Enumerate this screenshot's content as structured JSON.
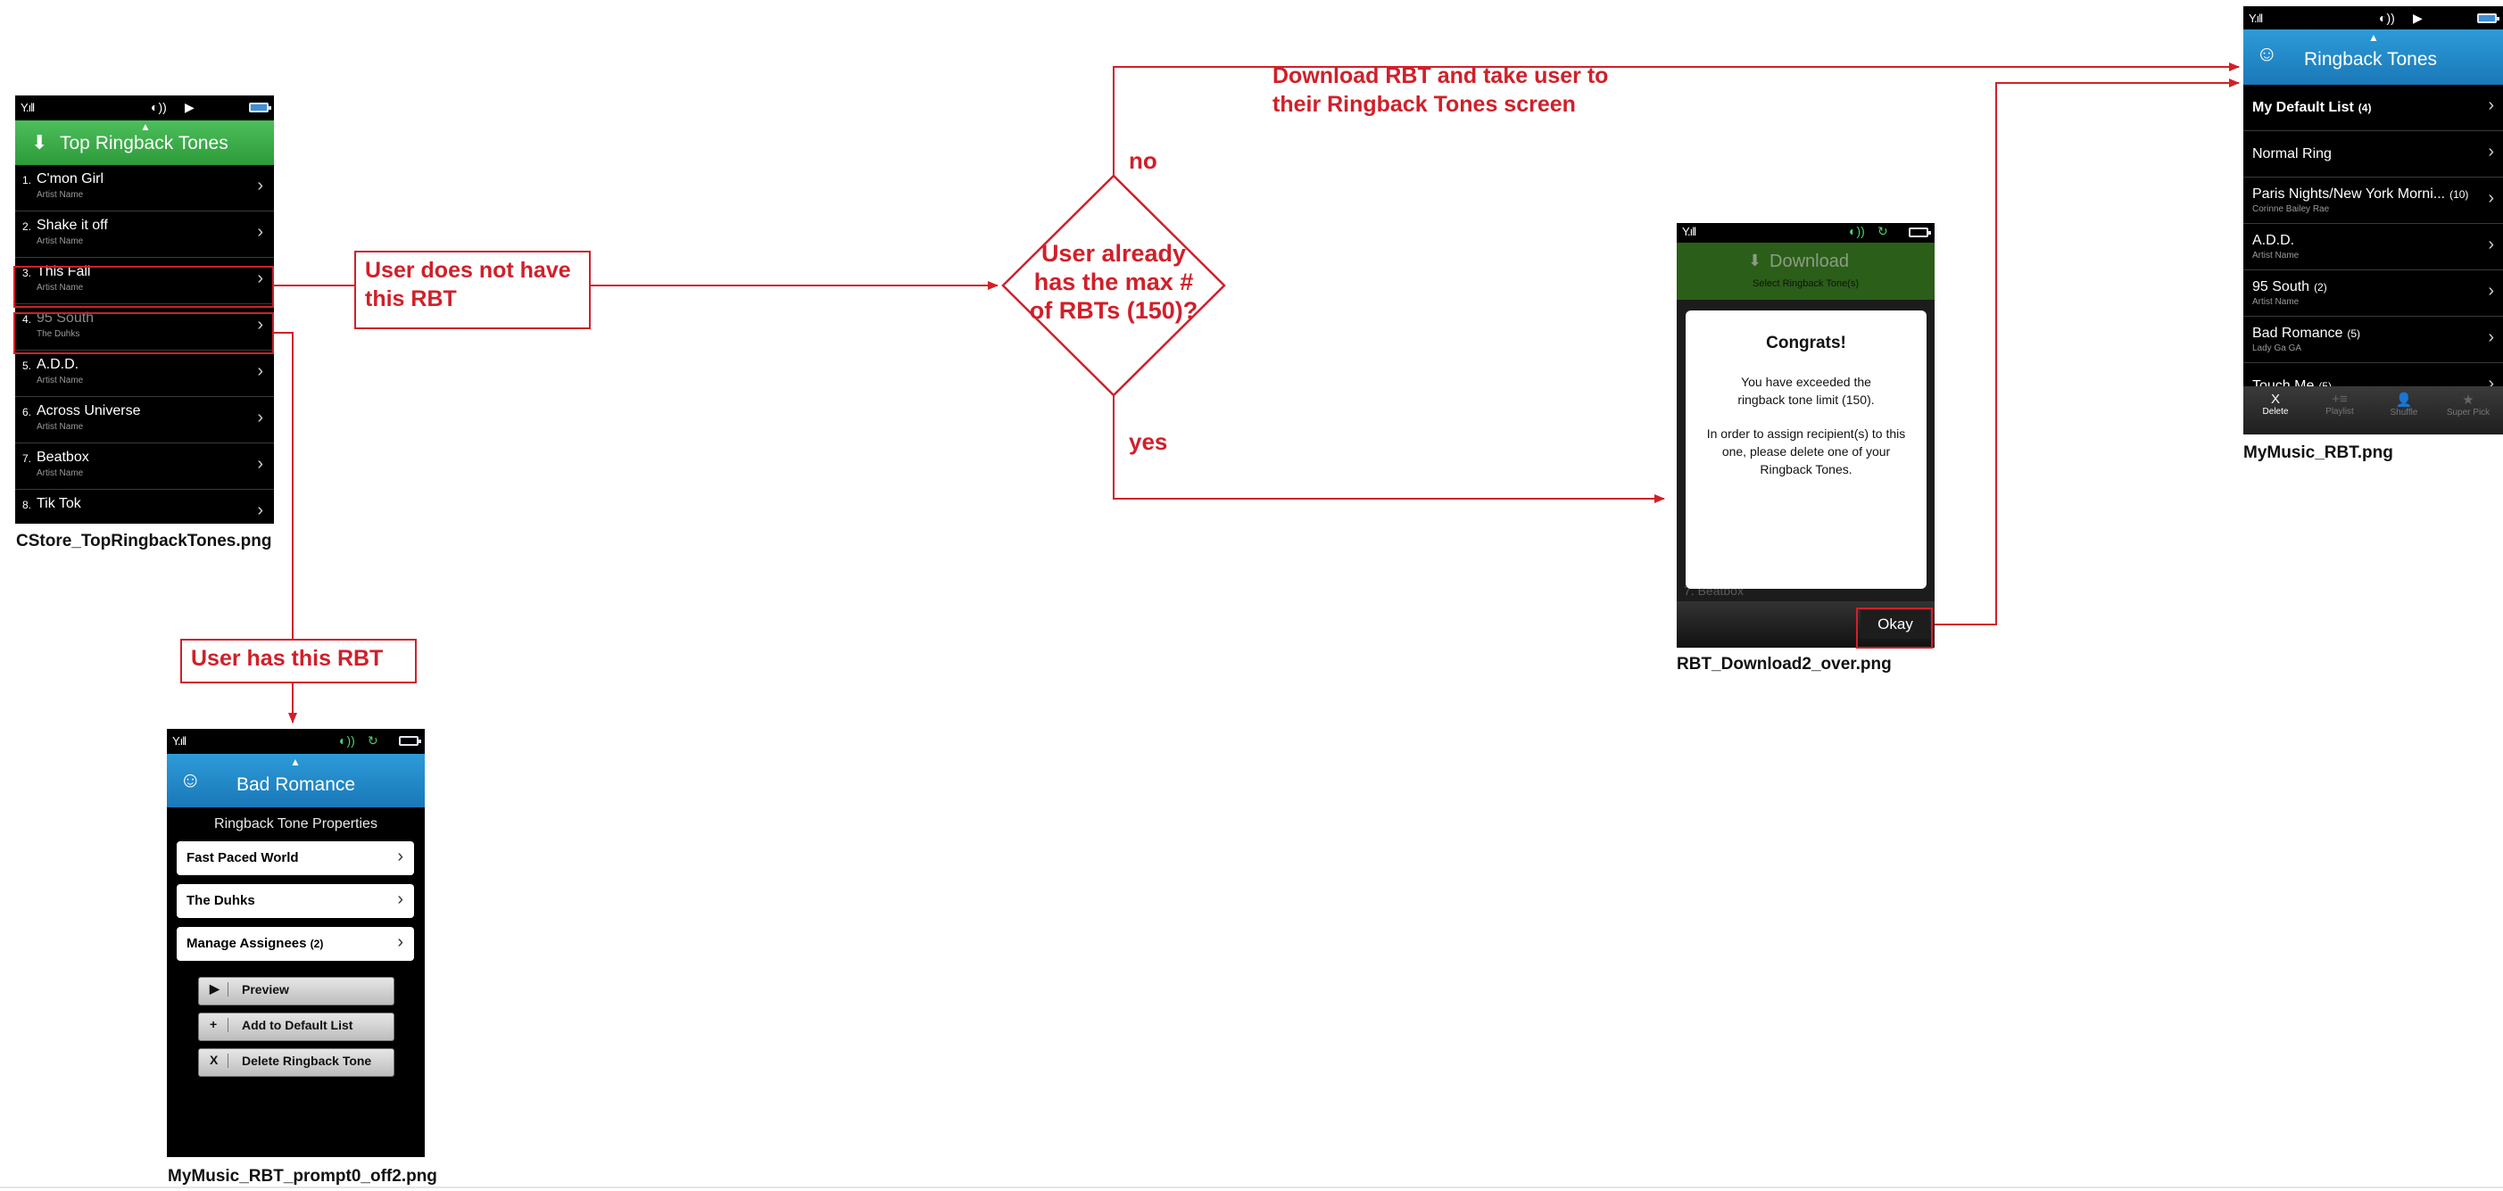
{
  "flow": {
    "no_label": "no",
    "yes_label": "yes",
    "no_branch_note": "Download RBT and take user to their Ringback Tones screen",
    "no_branch_note_line1": "Download RBT and take user to",
    "no_branch_note_line2": "their Ringback Tones screen",
    "not_have_note_line1": "User does not have",
    "not_have_note_line2": "this RBT",
    "has_note": "User has this RBT",
    "decision_line1": "User already",
    "decision_line2": "has the max #",
    "decision_line3": "of RBTs (150)?",
    "accent_color": "#d0202a"
  },
  "screens": {
    "top_ringback": {
      "caption": "CStore_TopRingbackTones.png",
      "header_title": "Top Ringback Tones",
      "header_icon": "download-arrow-icon",
      "rows": [
        {
          "num": "1.",
          "title": "C'mon Girl",
          "sub": "Artist Name"
        },
        {
          "num": "2.",
          "title": "Shake it off",
          "sub": "Artist Name"
        },
        {
          "num": "3.",
          "title": "This Fall",
          "sub": "Artist Name"
        },
        {
          "num": "4.",
          "title": "95 South",
          "sub": "The Duhks"
        },
        {
          "num": "5.",
          "title": "A.D.D.",
          "sub": "Artist Name"
        },
        {
          "num": "6.",
          "title": "Across Universe",
          "sub": "Artist Name"
        },
        {
          "num": "7.",
          "title": "Beatbox",
          "sub": "Artist Name"
        },
        {
          "num": "8.",
          "title": "Tik Tok",
          "sub": ""
        }
      ]
    },
    "prompt": {
      "caption": "MyMusic_RBT_prompt0_off2.png",
      "header_title": "Bad Romance",
      "section_title": "Ringback Tone Properties",
      "items": [
        {
          "label": "Fast Paced World"
        },
        {
          "label": "The Duhks"
        },
        {
          "label": "Manage Assignees",
          "count": "(2)"
        }
      ],
      "buttons": [
        {
          "glyph": "▶",
          "label": "Preview"
        },
        {
          "glyph": "+",
          "label": "Add to Default List"
        },
        {
          "glyph": "X",
          "label": "Delete Ringback Tone"
        }
      ]
    },
    "download": {
      "caption": "RBT_Download2_over.png",
      "header_title": "Download",
      "header_sub": "Select Ringback Tone(s)",
      "dialog_title": "Congrats!",
      "dialog_line1": "You have exceeded the ringback tone limit (150).",
      "dialog_line2": "In order to assign recipient(s) to this one, please delete one of your Ringback Tones.",
      "background_row": "7. Beatbox",
      "okay_label": "Okay"
    },
    "mymusic": {
      "caption": "MyMusic_RBT.png",
      "header_title": "Ringback Tones",
      "rows": [
        {
          "title": "My Default List",
          "count": "(4)",
          "sub": "",
          "bold": true
        },
        {
          "title": "Normal Ring",
          "count": "",
          "sub": ""
        },
        {
          "title": "Paris Nights/New York Morni...",
          "count": "(10)",
          "sub": "Corinne Bailey Rae"
        },
        {
          "title": "A.D.D.",
          "count": "",
          "sub": "Artist Name"
        },
        {
          "title": "95 South",
          "count": "(2)",
          "sub": "Artist Name"
        },
        {
          "title": "Bad Romance",
          "count": "(5)",
          "sub": "Lady Ga GA"
        },
        {
          "title": "Touch Me",
          "count": "(5)",
          "sub": ""
        }
      ],
      "toolbar": [
        {
          "glyph": "X",
          "label": "Delete",
          "icon": "delete-icon"
        },
        {
          "glyph": "+≡",
          "label": "Playlist",
          "icon": "playlist-icon"
        },
        {
          "glyph": "👤",
          "label": "Shuffle",
          "icon": "assign-icon"
        },
        {
          "glyph": "★",
          "label": "Super Pick",
          "icon": "super-pick-icon"
        }
      ]
    }
  }
}
